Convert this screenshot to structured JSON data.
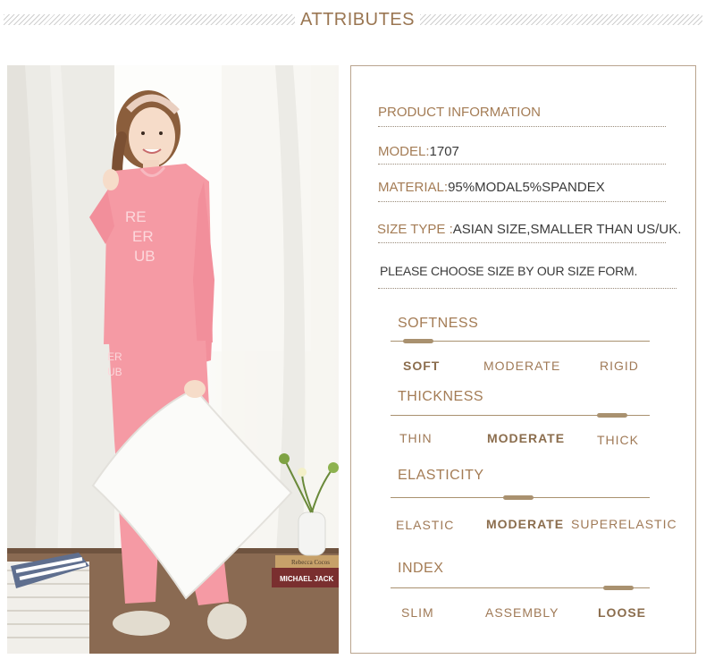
{
  "header": {
    "title": "ATTRIBUTES"
  },
  "product": {
    "heading": "PRODUCT INFORMATION",
    "model_label": "MODEL:",
    "model_value": "1707",
    "material_label": "MATERIAL:",
    "material_value": "95%MODAL5%SPANDEX",
    "size_label": "SIZE TYPE :",
    "size_value": "ASIAN SIZE,SMALLER THAN US/UK.",
    "note": "PLEASE CHOOSE SIZE BY OUR SIZE FORM."
  },
  "scales": [
    {
      "title": "SOFTNESS",
      "options": [
        "SOFT",
        "MODERATE",
        "RIGID"
      ],
      "selected": "SOFT"
    },
    {
      "title": "THICKNESS",
      "options": [
        "THIN",
        "MODERATE",
        "THICK"
      ],
      "selected": "MODERATE"
    },
    {
      "title": "ELASTICITY",
      "options": [
        "ELASTIC",
        "MODERATE",
        "SUPERELASTIC"
      ],
      "selected": "MODERATE"
    },
    {
      "title": "INDEX",
      "options": [
        "SLIM",
        "ASSEMBLY",
        "LOOSE"
      ],
      "selected": "LOOSE"
    }
  ],
  "photo": {
    "alt": "",
    "shirt_print": [
      "RE",
      "ER",
      "UB"
    ],
    "pants_print": [
      "ER",
      "UB"
    ],
    "book_spines": [
      "Rebecca Cocos",
      "MICHAEL JACK"
    ]
  },
  "colors": {
    "accent": "#a47c55",
    "pink": "#f59aa4",
    "frame": "#b9a48e"
  }
}
